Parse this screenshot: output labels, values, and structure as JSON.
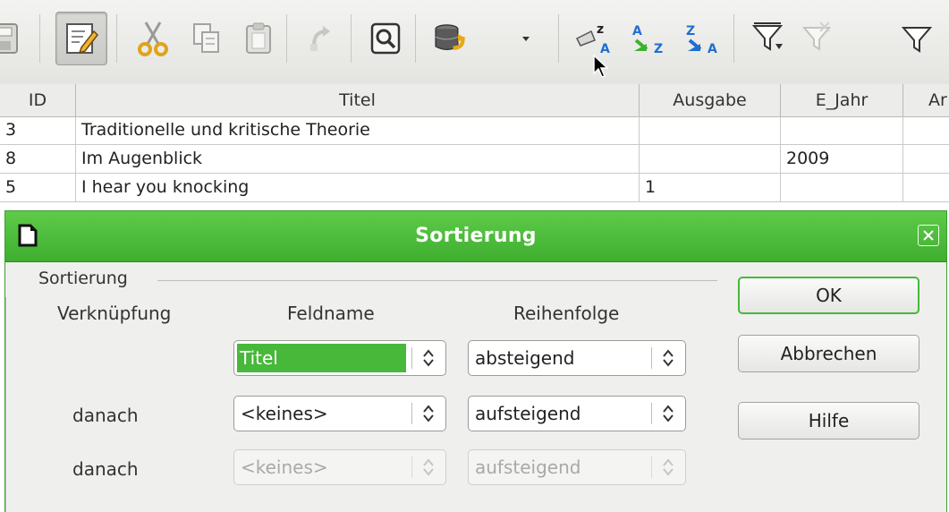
{
  "toolbar": {
    "icons": [
      "save-icon",
      "edit-mode-icon",
      "cut-icon",
      "copy-icon",
      "paste-icon",
      "undo-icon",
      "find-record-icon",
      "data-source-icon",
      "dropdown-arrow-icon",
      "sort-dialog-icon",
      "sort-ascending-icon",
      "sort-descending-icon",
      "autofilter-icon",
      "apply-filter-icon",
      "standard-filter-icon"
    ]
  },
  "grid": {
    "columns": [
      "ID",
      "Titel",
      "Ausgabe",
      "E_Jahr",
      "Ar"
    ],
    "rows": [
      [
        "3",
        "Traditionelle und kritische Theorie",
        "",
        "",
        ""
      ],
      [
        "8",
        "Im Augenblick",
        "",
        "2009",
        ""
      ],
      [
        "5",
        "I hear you knocking",
        "1",
        "",
        ""
      ]
    ]
  },
  "dialog": {
    "title": "Sortierung",
    "group_label": "Sortierung",
    "col_link": "Verknüpfung",
    "col_field": "Feldname",
    "col_order": "Reihenfolge",
    "sort_rows": [
      {
        "link": "",
        "field": "Titel",
        "order": "absteigend",
        "enabled": true
      },
      {
        "link": "danach",
        "field": "<keines>",
        "order": "aufsteigend",
        "enabled": true
      },
      {
        "link": "danach",
        "field": "<keines>",
        "order": "aufsteigend",
        "enabled": false
      }
    ],
    "buttons": {
      "ok": "OK",
      "cancel": "Abbrechen",
      "help": "Hilfe"
    }
  },
  "colors": {
    "accent": "#47b83a",
    "titlebar": "#4fbf3d"
  }
}
